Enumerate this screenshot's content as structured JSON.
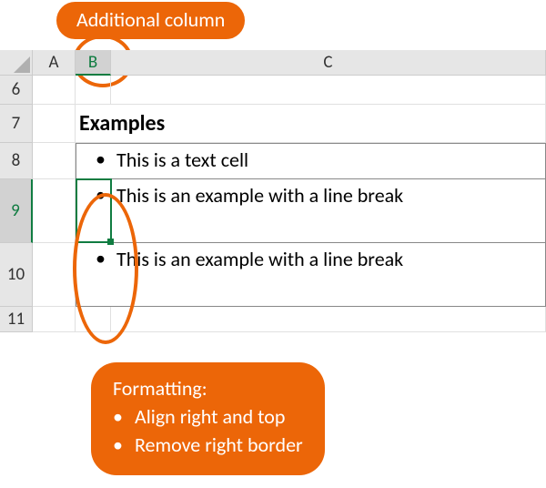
{
  "annotations": {
    "top_label": "Additional column",
    "bottom_heading": "Formatting:",
    "bottom_bullets": [
      "Align right and top",
      "Remove right border"
    ]
  },
  "columns": {
    "A": "A",
    "B": "B",
    "C": "C"
  },
  "rows": {
    "r6": "6",
    "r7": "7",
    "r8": "8",
    "r9": "9",
    "r10": "10",
    "r11": "11"
  },
  "bullet": "•",
  "content": {
    "heading": "Examples",
    "row8": "This is a text cell",
    "row9": "This is an example with a line break",
    "row10": "This is an example with a line break"
  },
  "selected_cell": "B9"
}
